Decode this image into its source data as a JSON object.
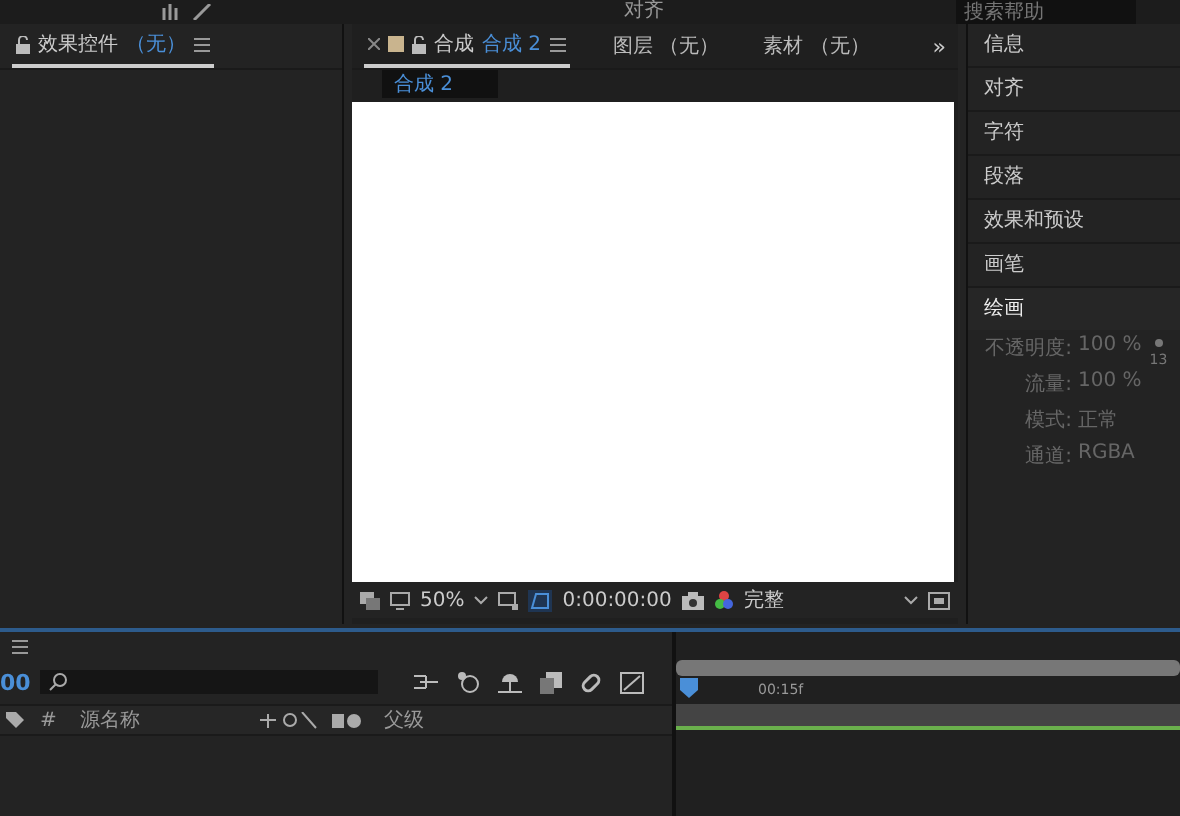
{
  "toolbar": {
    "align_label": "对齐",
    "search": {
      "placeholder": "搜索帮助"
    }
  },
  "effects_panel": {
    "tab": {
      "label": "效果控件",
      "target": "（无）",
      "selected": true
    }
  },
  "viewer": {
    "tabs": [
      {
        "kind": "comp",
        "label": "合成",
        "name": "合成 2",
        "selected": true
      },
      {
        "kind": "plain",
        "label": "图层 （无）",
        "selected": false
      },
      {
        "kind": "plain",
        "label": "素材 （无）",
        "selected": false
      }
    ],
    "overflow": "»",
    "breadcrumb": "合成 2",
    "zoom": "50%",
    "timecode": "0:00:00:00",
    "resolution": "完整"
  },
  "side_panel": {
    "items": [
      {
        "label": "信息",
        "expanded": false
      },
      {
        "label": "对齐",
        "expanded": false
      },
      {
        "label": "字符",
        "expanded": false
      },
      {
        "label": "段落",
        "expanded": false
      },
      {
        "label": "效果和预设",
        "expanded": false
      },
      {
        "label": "画笔",
        "expanded": false
      },
      {
        "label": "绘画",
        "expanded": true
      }
    ],
    "paint": {
      "fields": [
        {
          "label": "不透明度:",
          "value": "100 %"
        },
        {
          "label": "流量:",
          "value": "100 %"
        },
        {
          "label": "模式:",
          "value": "正常"
        },
        {
          "label": "通道:",
          "value": "RGBA"
        }
      ],
      "brush_size": "13"
    }
  },
  "timeline": {
    "time": "00",
    "columns": {
      "number": "#",
      "source_name": "源名称",
      "parent": "父级"
    },
    "ruler_label": "00:15f"
  }
}
